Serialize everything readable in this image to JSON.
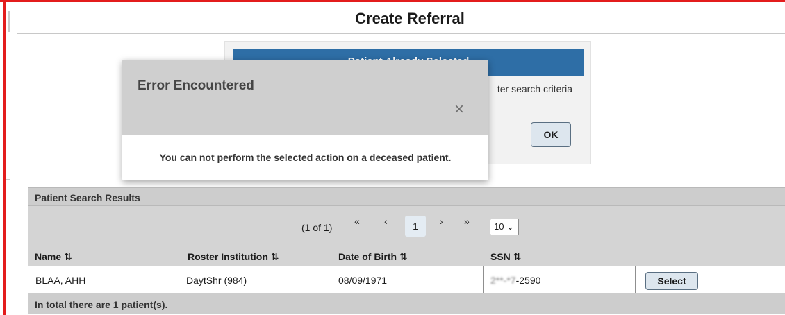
{
  "page": {
    "title": "Create Referral"
  },
  "background_panel": {
    "header": "Patient Already Selected",
    "text": "ter search criteria",
    "ok_label": "OK"
  },
  "error_modal": {
    "title": "Error Encountered",
    "close_glyph": "×",
    "message": "You can not perform the selected action on a deceased patient."
  },
  "results": {
    "heading": "Patient Search Results",
    "pager": {
      "count_text": "(1 of 1)",
      "first_glyph": "«",
      "prev_glyph": "‹",
      "current_page": "1",
      "next_glyph": "›",
      "last_glyph": "»",
      "per_page": "10 ⌄"
    },
    "columns": [
      "Name ⇅",
      "Roster Institution ⇅",
      "Date of Birth ⇅",
      "SSN ⇅"
    ],
    "rows": [
      {
        "name": "BLAA, AHH",
        "roster_institution": "DaytShr (984)",
        "dob": "08/09/1971",
        "ssn_masked": "2**-*7",
        "ssn_tail": "-2590",
        "action": "Select"
      }
    ],
    "footer": "In total there are 1 patient(s)."
  }
}
